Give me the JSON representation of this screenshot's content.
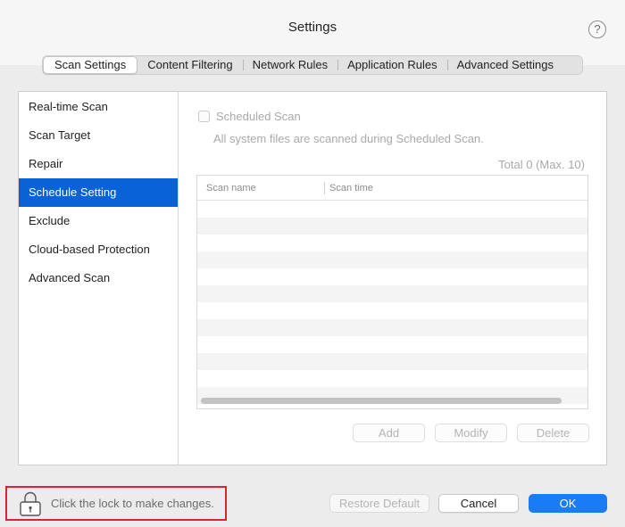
{
  "window": {
    "title": "Settings"
  },
  "help": {
    "label": "?"
  },
  "tabs": [
    {
      "label": "Scan Settings"
    },
    {
      "label": "Content Filtering"
    },
    {
      "label": "Network Rules"
    },
    {
      "label": "Application Rules"
    },
    {
      "label": "Advanced Settings"
    }
  ],
  "sidebar": {
    "items": [
      {
        "label": "Real-time Scan"
      },
      {
        "label": "Scan Target"
      },
      {
        "label": "Repair"
      },
      {
        "label": "Schedule Setting"
      },
      {
        "label": "Exclude"
      },
      {
        "label": "Cloud-based Protection"
      },
      {
        "label": "Advanced Scan"
      }
    ],
    "selected": "Schedule Setting"
  },
  "schedule": {
    "checkbox_label": "Scheduled Scan",
    "checked": false,
    "description": "All system files are scanned during Scheduled Scan.",
    "total": "Total 0 (Max. 10)",
    "columns": [
      "Scan name",
      "Scan time"
    ],
    "rows": [],
    "buttons": {
      "add": "Add",
      "modify": "Modify",
      "delete": "Delete"
    }
  },
  "footer": {
    "lock_text": "Click the lock to make changes.",
    "restore": "Restore Default",
    "cancel": "Cancel",
    "ok": "OK"
  },
  "colors": {
    "accent": "#0a63d6",
    "ok_button": "#1a7cf5",
    "highlight_border": "#d8262d"
  },
  "icons": {
    "help": "question-mark-icon",
    "lock": "lock-icon"
  }
}
